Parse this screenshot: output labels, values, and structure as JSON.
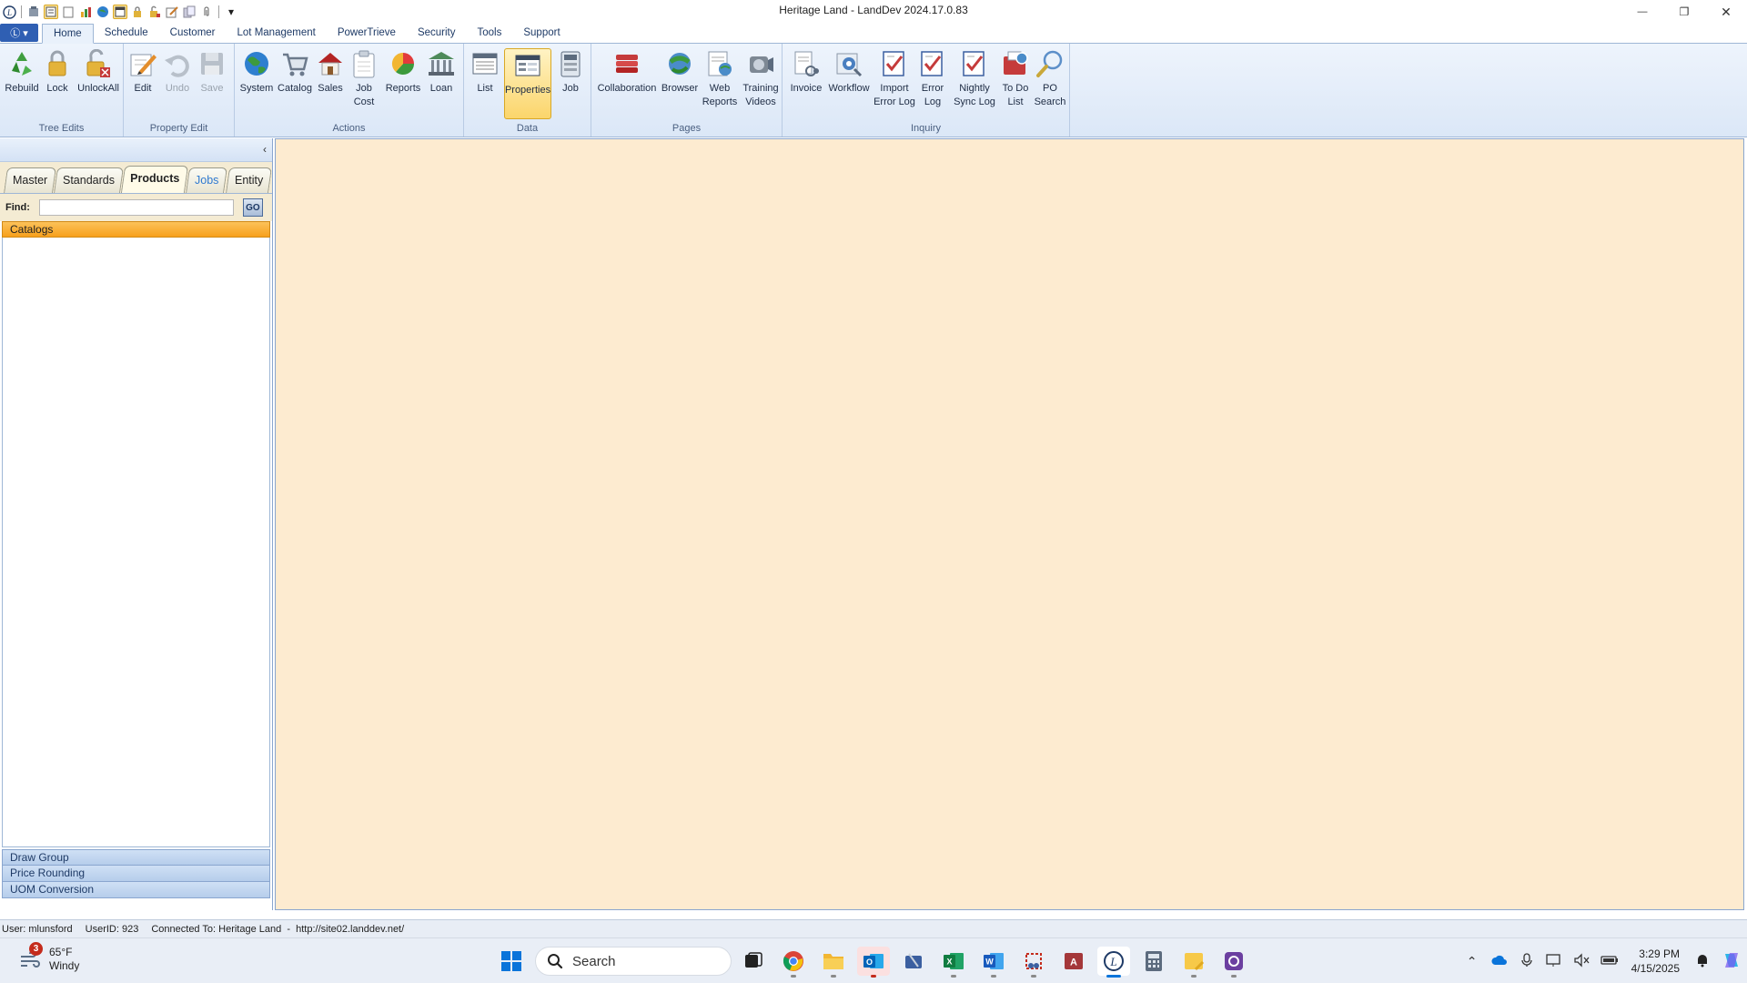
{
  "window": {
    "title": "Heritage Land - LandDev 2024.17.0.83",
    "minimize_glyph": "—",
    "restore_glyph": "❐",
    "close_glyph": "✕"
  },
  "quick_access": {
    "customize_glyph": "▾"
  },
  "ribbon": {
    "app_button_glyph": "Ⓛ ▾",
    "tabs": [
      "Home",
      "Schedule",
      "Customer",
      "Lot Management",
      "PowerTrieve",
      "Security",
      "Tools",
      "Support"
    ],
    "groups": {
      "tree_edits": {
        "label": "Tree Edits",
        "buttons": [
          {
            "label": "Rebuild",
            "icon": "recycle-icon"
          },
          {
            "label": "Lock",
            "icon": "lock-icon"
          },
          {
            "label": "UnlockAll",
            "icon": "unlock-all-icon"
          }
        ]
      },
      "property_edit": {
        "label": "Property Edit",
        "buttons": [
          {
            "label": "Edit",
            "icon": "edit-icon"
          },
          {
            "label": "Undo",
            "icon": "undo-icon",
            "disabled": true
          },
          {
            "label": "Save",
            "icon": "save-icon",
            "disabled": true
          }
        ]
      },
      "actions": {
        "label": "Actions",
        "buttons": [
          {
            "label": "System",
            "icon": "globe-icon"
          },
          {
            "label": "Catalog",
            "icon": "cart-icon"
          },
          {
            "label": "Sales",
            "icon": "house-icon"
          },
          {
            "label": "Job Cost",
            "label_line1": "Job",
            "label_line2": "Cost",
            "icon": "clipboard-icon"
          },
          {
            "label": "Reports",
            "icon": "chart-icon"
          },
          {
            "label": "Loan",
            "icon": "bank-icon"
          }
        ]
      },
      "data": {
        "label": "Data",
        "buttons": [
          {
            "label": "List",
            "icon": "list-icon"
          },
          {
            "label": "Properties",
            "icon": "properties-icon",
            "selected": true
          },
          {
            "label": "Job",
            "icon": "job-icon"
          }
        ]
      },
      "pages": {
        "label": "Pages",
        "buttons": [
          {
            "label": "Collaboration",
            "icon": "collaboration-icon"
          },
          {
            "label": "Browser",
            "icon": "browser-icon"
          },
          {
            "label_line1": "Web",
            "label_line2": "Reports",
            "icon": "web-reports-icon"
          },
          {
            "label_line1": "Training",
            "label_line2": "Videos",
            "icon": "training-videos-icon"
          }
        ]
      },
      "inquiry": {
        "label": "Inquiry",
        "buttons": [
          {
            "label": "Invoice",
            "icon": "invoice-icon"
          },
          {
            "label": "Workflow",
            "icon": "workflow-icon"
          },
          {
            "label_line1": "Import",
            "label_line2": "Error Log",
            "icon": "import-error-log-icon"
          },
          {
            "label_line1": "Error",
            "label_line2": "Log",
            "icon": "error-log-icon"
          },
          {
            "label_line1": "Nightly",
            "label_line2": "Sync Log",
            "icon": "sync-log-icon"
          },
          {
            "label_line1": "To Do",
            "label_line2": "List",
            "icon": "todo-list-icon"
          },
          {
            "label_line1": "PO",
            "label_line2": "Search",
            "icon": "search-icon"
          }
        ]
      }
    }
  },
  "left_pane": {
    "collapse_glyph": "‹",
    "tabs": [
      "Master",
      "Standards",
      "Products",
      "Jobs",
      "Entity"
    ],
    "active_tab": "Products",
    "find_label": "Find:",
    "find_value": "",
    "go_label": "GO",
    "sections": {
      "expanded": "Catalogs",
      "collapsed": [
        "Draw Group",
        "Price Rounding",
        "UOM Conversion"
      ]
    }
  },
  "status_bar": {
    "user": "User: mlunsford",
    "user_id": "UserID: 923",
    "connection": "Connected To: Heritage Land  -  http://site02.landdev.net/"
  },
  "taskbar": {
    "weather": {
      "temp": "65°F",
      "condition": "Windy",
      "badge": "3"
    },
    "search_placeholder": "Search",
    "clock": {
      "time": "3:29 PM",
      "date": "4/15/2025"
    }
  },
  "colors": {
    "ribbon_bg": "#dbe7f7",
    "main_area_bg": "#fdebd0",
    "catalogs_header": "#f7a01c",
    "selected_button": "#fbd56b",
    "accent_blue": "#2f5fb3"
  }
}
